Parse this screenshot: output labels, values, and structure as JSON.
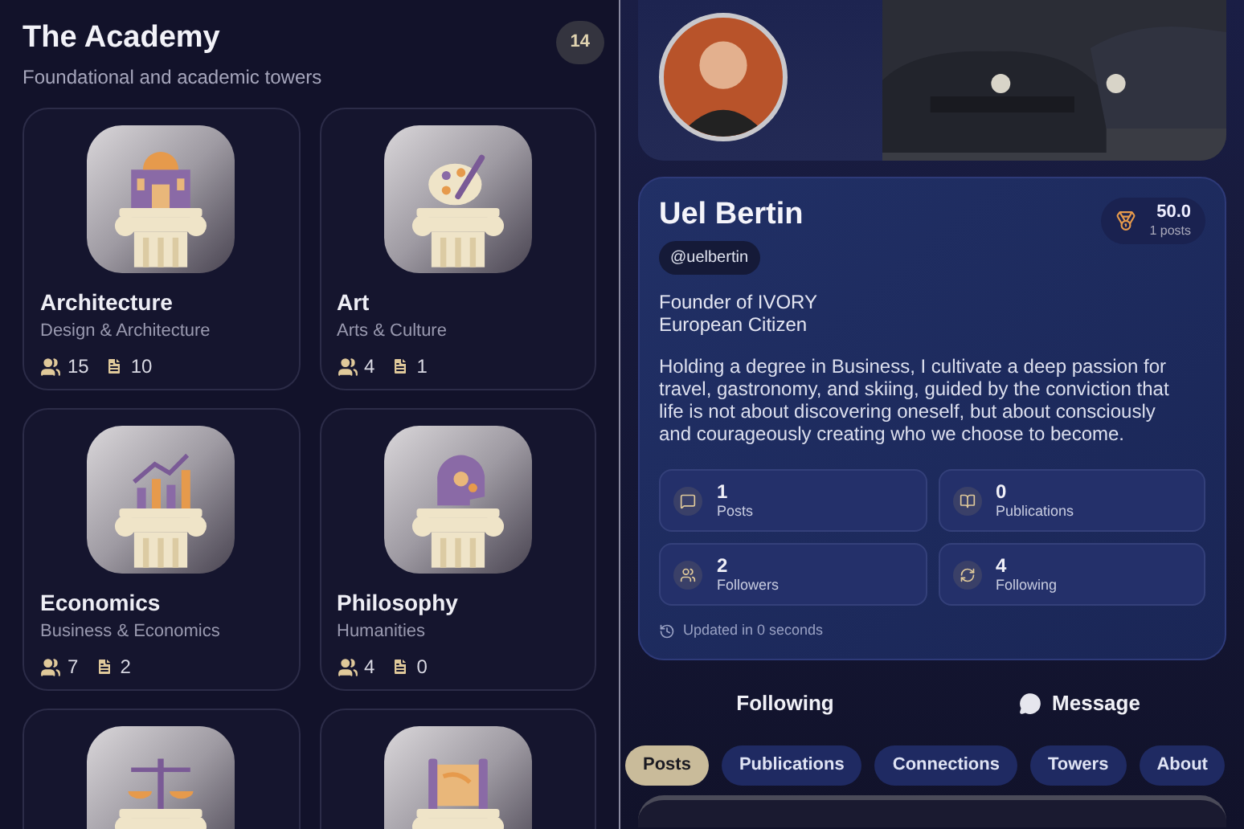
{
  "academy": {
    "title": "The Academy",
    "subtitle": "Foundational and academic towers",
    "count": "14"
  },
  "towers": [
    {
      "kind": "architecture",
      "name": "Architecture",
      "category": "Design & Architecture",
      "members": "15",
      "documents": "10"
    },
    {
      "kind": "art",
      "name": "Art",
      "category": "Arts & Culture",
      "members": "4",
      "documents": "1"
    },
    {
      "kind": "economics",
      "name": "Economics",
      "category": "Business & Economics",
      "members": "7",
      "documents": "2"
    },
    {
      "kind": "philosophy",
      "name": "Philosophy",
      "category": "Humanities",
      "members": "4",
      "documents": "0"
    },
    {
      "kind": "law"
    },
    {
      "kind": "history"
    }
  ],
  "profile": {
    "name": "Uel Bertin",
    "handle": "@uelbertin",
    "score": "50.0",
    "score_caption": "1 posts",
    "headline": [
      "Founder of IVORY",
      "European Citizen"
    ],
    "bio": "Holding a degree in Business, I cultivate a deep passion for travel, gastronomy, and skiing, guided by the conviction that life is not about discovering oneself, but about consciously and courageously creating who we choose to become.",
    "stats": [
      {
        "kind": "posts",
        "value": "1",
        "label": "Posts"
      },
      {
        "kind": "publications",
        "value": "0",
        "label": "Publications"
      },
      {
        "kind": "followers",
        "value": "2",
        "label": "Followers"
      },
      {
        "kind": "following",
        "value": "4",
        "label": "Following"
      }
    ],
    "updated": "Updated in 0 seconds"
  },
  "actions": {
    "follow": "Following",
    "message": "Message"
  },
  "tabs": [
    {
      "label": "Posts",
      "selected": true
    },
    {
      "label": "Publications",
      "selected": false
    },
    {
      "label": "Connections",
      "selected": false
    },
    {
      "label": "Towers",
      "selected": false
    },
    {
      "label": "About",
      "selected": false
    }
  ]
}
